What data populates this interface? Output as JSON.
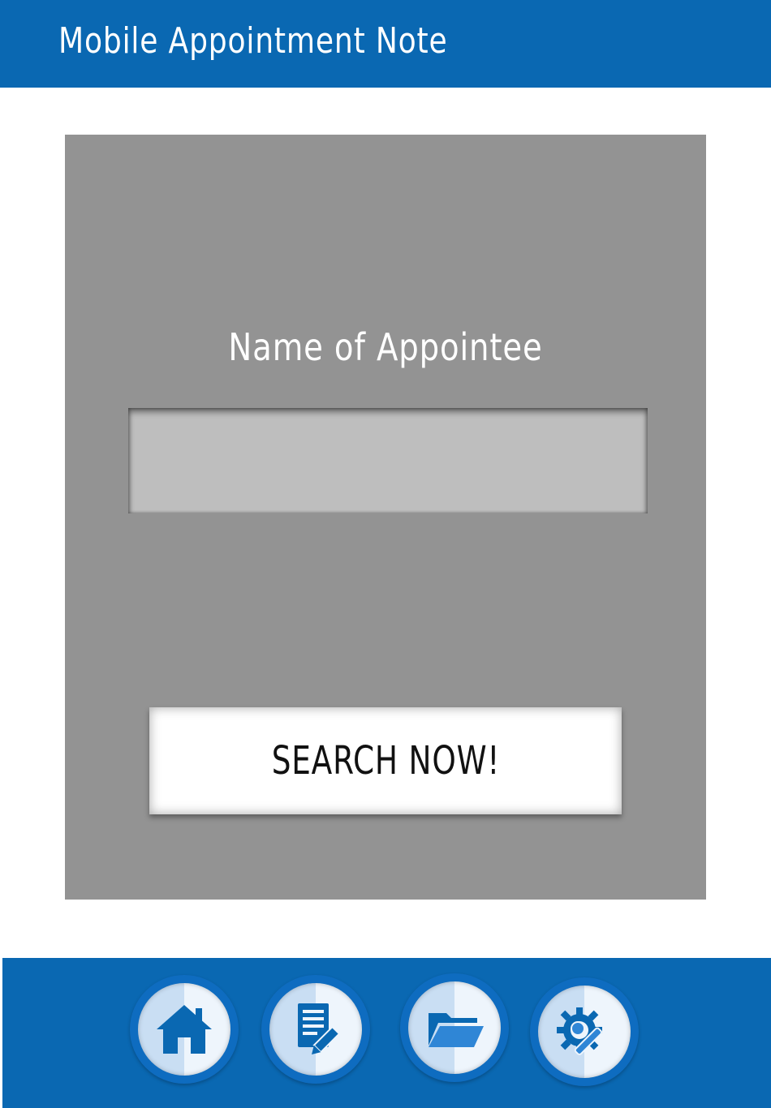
{
  "app": {
    "title": "Mobile Appointment Note"
  },
  "form": {
    "label": "Name of Appointee",
    "input_value": "",
    "input_placeholder": ""
  },
  "actions": {
    "search_label": "SEARCH NOW!"
  },
  "nav": {
    "items": [
      {
        "icon": "home-icon"
      },
      {
        "icon": "document-edit-icon"
      },
      {
        "icon": "folder-open-icon"
      },
      {
        "icon": "settings-wrench-gear-icon"
      }
    ]
  },
  "colors": {
    "brand_blue": "#0a68b2",
    "panel_gray": "#939393",
    "input_gray": "#bebebe",
    "icon_blue": "#0a68b2"
  }
}
